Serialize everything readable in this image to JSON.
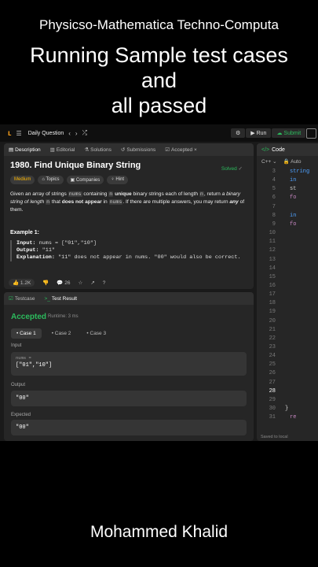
{
  "captions": {
    "line1": "Physicso-Mathematica Techno-Computa",
    "line2": "Running Sample test cases",
    "line3": "and",
    "line4": "all passed",
    "author": "Mohammed Khalid"
  },
  "topbar": {
    "title": "Daily Question",
    "run_label": "Run",
    "submit_label": "Submit"
  },
  "left_tabs": [
    "Description",
    "Editorial",
    "Solutions",
    "Submissions",
    "Accepted"
  ],
  "problem": {
    "title": "1980. Find Unique Binary String",
    "status": "Solved",
    "difficulty": "Medium",
    "chips": [
      "Topics",
      "Companies",
      "Hint"
    ],
    "para_a": "Given an array of strings",
    "nums": "nums",
    "para_b": "containing",
    "n": "n",
    "unique": "unique",
    "para_c": "binary strings each of length",
    "para_d": ", return",
    "para_e": "a binary string of length",
    "para_f": "that",
    "not_appear": "does not appear",
    "para_g": "in",
    "para_h": ". If there are multiple answers, you may return",
    "any": "any",
    "para_i": "of them.",
    "example_title": "Example 1:",
    "input_label": "Input:",
    "input_val": "nums = [\"01\",\"10\"]",
    "output_label": "Output:",
    "output_val": "\"11\"",
    "expl_label": "Explanation:",
    "expl_val": "\"11\" does not appear in nums. \"00\" would also be correct.",
    "likes": "1.2K",
    "comments": "26"
  },
  "result": {
    "tab_testcase": "Testcase",
    "tab_result": "Test Result",
    "verdict": "Accepted",
    "runtime": "Runtime: 3 ms",
    "cases": [
      "Case 1",
      "Case 2",
      "Case 3"
    ],
    "input_label": "Input",
    "param_name": "nums =",
    "param_value": "[\"01\",\"10\"]",
    "output_label": "Output",
    "output_value": "\"00\"",
    "expected_label": "Expected",
    "expected_value": "\"00\""
  },
  "editor": {
    "tab": "Code",
    "lang": "C++",
    "mode": "Auto",
    "line_numbers": [
      "3",
      "4",
      "5",
      "6",
      "7",
      "8",
      "9",
      "10",
      "11",
      "12",
      "13",
      "14",
      "15",
      "16",
      "17",
      "18",
      "19",
      "20",
      "21",
      "22",
      "23",
      "24",
      "25",
      "26",
      "27",
      "28",
      "29",
      "30",
      "31"
    ],
    "current_line": "28",
    "visible_code": [
      {
        "line": "3",
        "text": "string"
      },
      {
        "line": "4",
        "text": "in"
      },
      {
        "line": "5",
        "text": "st"
      },
      {
        "line": "6",
        "text": "fo"
      },
      {
        "line": "8",
        "text": "in"
      },
      {
        "line": "9",
        "text": "fo"
      },
      {
        "line": "30",
        "text": "}"
      },
      {
        "line": "31",
        "text": "re"
      }
    ],
    "saved": "Saved to local"
  },
  "colors": {
    "accent_green": "#2cbb5d",
    "medium_yellow": "#ffb800",
    "brand_orange": "#f89f1b"
  }
}
